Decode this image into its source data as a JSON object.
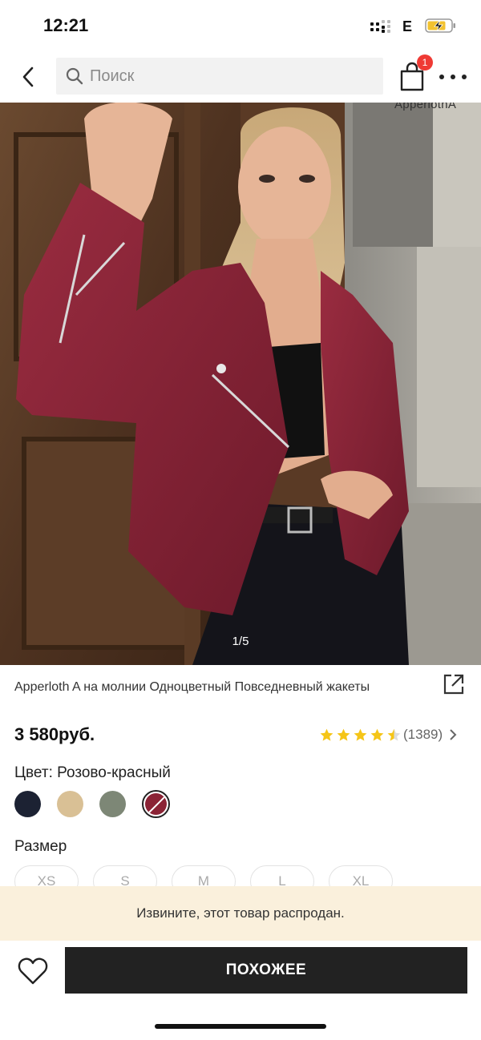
{
  "status_bar": {
    "time": "12:21",
    "carrier": "E"
  },
  "header": {
    "search_placeholder": "Поиск",
    "cart_badge": "1",
    "icons": [
      "back-arrow-icon",
      "search-icon",
      "shopping-bag-icon",
      "more-dots-icon"
    ]
  },
  "gallery": {
    "brand_watermark": "ApperlothA",
    "pager": "1/5",
    "current_index": 1,
    "total": 5
  },
  "product": {
    "title": "Apperloth A на молнии Одноцветный Повседневный жакеты",
    "price": "3 580руб.",
    "rating_value": 4.5,
    "review_count": "(1389)",
    "color_label": "Цвет: Розово-красный",
    "swatches": [
      {
        "name": "navy",
        "color": "#1c2233"
      },
      {
        "name": "beige",
        "color": "#d9c095"
      },
      {
        "name": "olive-grey",
        "color": "#7d8776"
      },
      {
        "name": "rose-red",
        "color": "#8b2335",
        "selected": true
      }
    ],
    "size_label": "Размер",
    "sizes": [
      "XS",
      "S",
      "M",
      "L",
      "XL"
    ]
  },
  "banner": {
    "sold_out": "Извините, этот товар распродан."
  },
  "bottom_bar": {
    "similar_label": "ПОХОЖЕЕ"
  },
  "colors": {
    "accent_dark": "#222222",
    "badge_red": "#ef3a34",
    "star_yellow": "#f5c518",
    "banner_bg": "#faf0dc"
  }
}
